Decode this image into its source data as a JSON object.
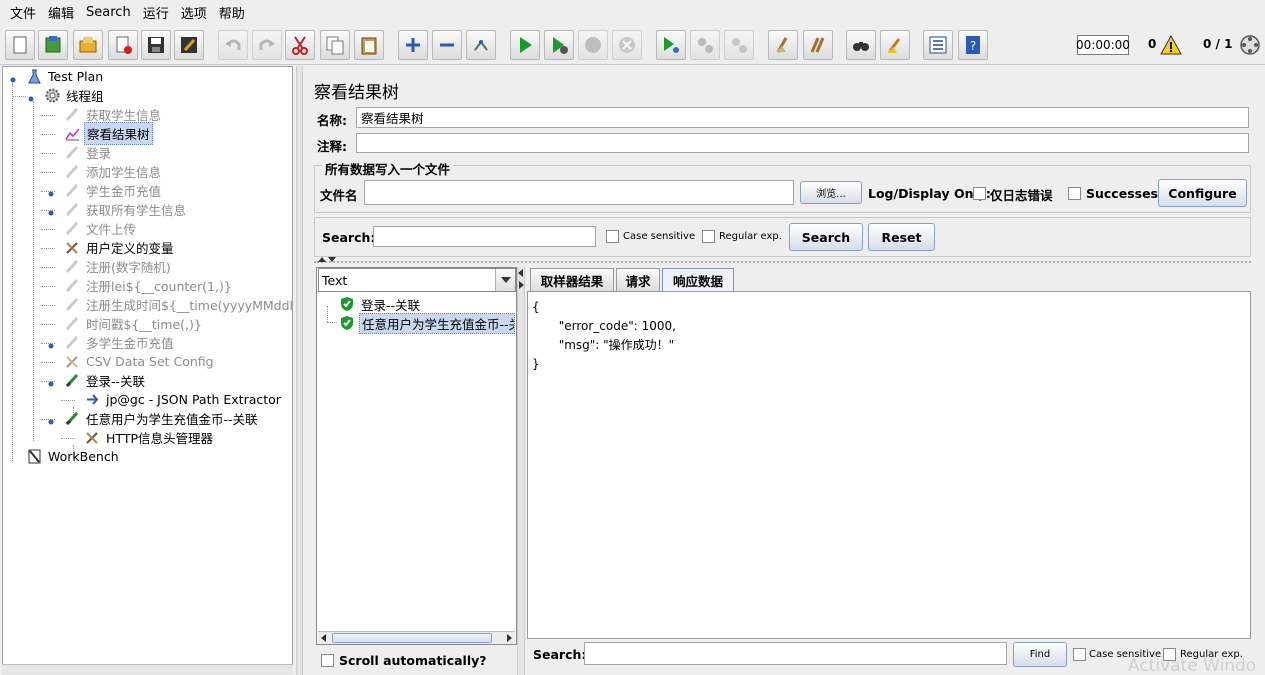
{
  "menu": [
    "文件",
    "编辑",
    "Search",
    "运行",
    "选项",
    "帮助"
  ],
  "toolbar": {
    "buttons": [
      "new-icon",
      "templates-icon",
      "open-icon",
      "close-icon",
      "save-icon",
      "save-as-icon",
      "undo-icon",
      "redo-icon",
      "cut-icon",
      "copy-icon",
      "paste-icon",
      "expand-icon",
      "collapse-icon",
      "toggle-icon",
      "start-icon",
      "start-no-pause-icon",
      "stop-icon",
      "shutdown-icon",
      "remote-start-icon",
      "remote-stop-icon",
      "remote-shutdown-icon",
      "clear-icon",
      "clear-all-icon",
      "search-icon",
      "reset-search-icon",
      "function-helper-icon",
      "help-icon"
    ],
    "timer": "00:00:00",
    "warnings": "0",
    "threads": "0 / 1"
  },
  "tree": {
    "items": [
      {
        "label": "Test Plan",
        "enabled": true
      },
      {
        "label": "线程组",
        "enabled": true
      },
      {
        "label": "获取学生信息",
        "enabled": false
      },
      {
        "label": "察看结果树",
        "enabled": true
      },
      {
        "label": "登录",
        "enabled": false
      },
      {
        "label": "添加学生信息",
        "enabled": false
      },
      {
        "label": "学生金币充值",
        "enabled": false
      },
      {
        "label": "获取所有学生信息",
        "enabled": false
      },
      {
        "label": "文件上传",
        "enabled": false
      },
      {
        "label": "用户定义的变量",
        "enabled": true
      },
      {
        "label": "注册(数字随机)",
        "enabled": false
      },
      {
        "label": "注册lei${__counter(1,)}",
        "enabled": false
      },
      {
        "label": "注册生成时间${__time(yyyyMMddhhmm",
        "enabled": false
      },
      {
        "label": "时间戳${__time(,)}",
        "enabled": false
      },
      {
        "label": "多学生金币充值",
        "enabled": false
      },
      {
        "label": "CSV Data Set Config",
        "enabled": false
      },
      {
        "label": "登录--关联",
        "enabled": true
      },
      {
        "label": "jp@gc - JSON Path Extractor",
        "enabled": true
      },
      {
        "label": "任意用户为学生充值金币--关联",
        "enabled": true
      },
      {
        "label": "HTTP信息头管理器",
        "enabled": true
      },
      {
        "label": "WorkBench",
        "enabled": true
      }
    ]
  },
  "panel": {
    "title": "察看结果树",
    "name_label": "名称:",
    "name_value": "察看结果树",
    "comment_label": "注释:",
    "comment_value": "",
    "file_group": "所有数据写入一个文件",
    "filename_label": "文件名",
    "filename_value": "",
    "browse_button": "浏览...",
    "log_display_label": "Log/Display Only:",
    "errors_only_label": "仅日志错误",
    "successes_label": "Successes",
    "configure_button": "Configure",
    "search_label": "Search:",
    "search_value": "",
    "case_sensitive_label": "Case sensitive",
    "regex_label": "Regular exp.",
    "search_button": "Search",
    "reset_button": "Reset"
  },
  "results": {
    "renderer": "Text",
    "items": [
      "登录--关联",
      "任意用户为学生充值金币--关联"
    ],
    "scroll_auto_label": "Scroll automatically?"
  },
  "tabs": [
    "取样器结果",
    "请求",
    "响应数据"
  ],
  "response": {
    "text": "{\n       \"error_code\": 1000,\n       \"msg\": \"操作成功！\"\n}"
  },
  "bottom_search": {
    "label": "Search:",
    "value": "",
    "find_button": "Find",
    "case_sensitive_label": "Case sensitive",
    "regex_label": "Regular exp."
  },
  "watermark": "Activate Windo"
}
